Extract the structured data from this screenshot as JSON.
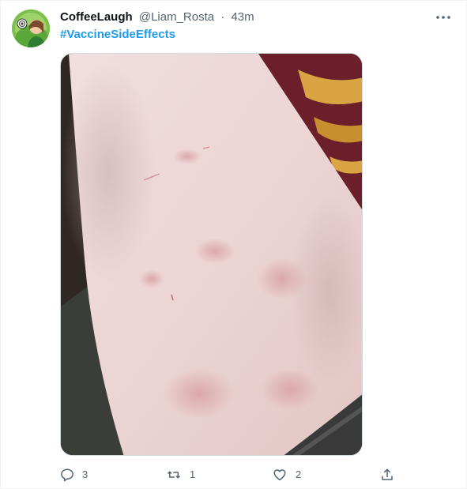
{
  "tweet": {
    "display_name": "CoffeeLaugh",
    "handle": "@Liam_Rosta",
    "separator": "·",
    "time": "43m",
    "hashtag": "#VaccineSideEffects",
    "media": {
      "subject": "forearm-skin-photo"
    }
  },
  "actions": {
    "reply_count": "3",
    "retweet_count": "1",
    "like_count": "2"
  },
  "icons": {
    "avatar": "avatar-icon",
    "more": "more-icon",
    "reply": "reply-icon",
    "retweet": "retweet-icon",
    "like": "heart-icon",
    "share": "share-icon"
  },
  "colors": {
    "hashtag": "#1d9bf0",
    "secondary_text": "#536471",
    "primary_text": "#0f1419"
  }
}
